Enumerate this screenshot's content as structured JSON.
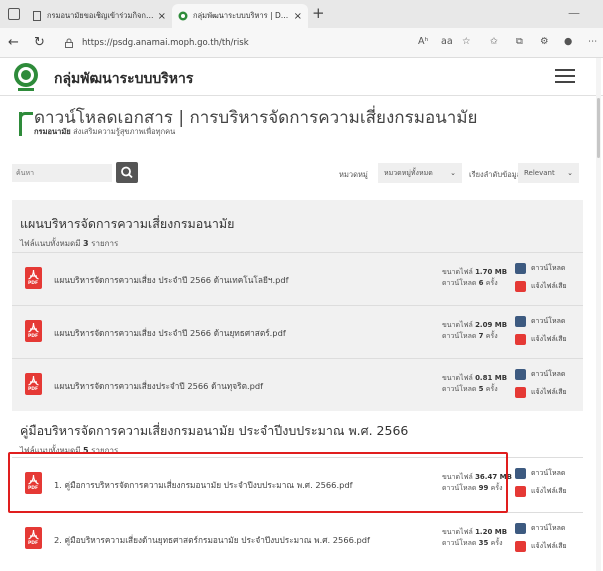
{
  "browser": {
    "tabs": [
      {
        "title": "กรมอนามัยขอเชิญเข้าร่วมกิจกรรม Inter..."
      },
      {
        "title": "กลุ่มพัฒนาระบบบริหาร | Document"
      }
    ],
    "new_tab": "+",
    "address": "https://psdg.anamai.moph.go.th/th/risk",
    "toolbar_text": "Aʰ",
    "reading": "aa"
  },
  "site": {
    "name": "กลุ่มพัฒนาระบบบริหาร"
  },
  "page": {
    "title": "ดาวน์โหลดเอกสาร | การบริหารจัดการความเสี่ยงกรมอนามัย",
    "subtitle_org": "กรมอนามัย",
    "subtitle_tagline": "ส่งเสริมความรู้สุขภาพเพื่อทุกคน"
  },
  "filters": {
    "search_placeholder": "ค้นหา",
    "category_label": "หมวดหมู่",
    "category_value": "หมวดหมู่ทั้งหมด",
    "sort_label": "เรียงลำดับข้อมูล",
    "sort_value": "Relevant"
  },
  "sections": [
    {
      "title": "แผนบริหารจัดการความเสี่ยงกรมอนามัย",
      "count_prefix": "ไฟล์แนบทั้งหมดมี",
      "count": "3",
      "count_suffix": "รายการ",
      "files": [
        {
          "name": "แผนบริหารจัดการความเสี่ยง ประจำปี 2566 ด้านเทคโนโลยีฯ.pdf",
          "size": "1.70 MB",
          "downloads": "6"
        },
        {
          "name": "แผนบริหารจัดการความเสี่ยง ประจำปี 2566 ด้านยุทธศาสตร์.pdf",
          "size": "2.09 MB",
          "downloads": "7"
        },
        {
          "name": "แผนบริหารจัดการความเสี่ยงประจำปี 2566 ด้านทุจริต.pdf",
          "size": "0.81 MB",
          "downloads": "5"
        }
      ]
    },
    {
      "title": "คู่มือบริหารจัดการความเสี่ยงกรมอนามัย ประจำปีงบประมาณ พ.ศ. 2566",
      "count_prefix": "ไฟล์แนบทั้งหมดมี",
      "count": "5",
      "count_suffix": "รายการ",
      "files": [
        {
          "name": "1. คู่มือการบริหารจัดการความเสี่ยงกรมอนามัย ประจำปีงบประมาณ พ.ศ. 2566.pdf",
          "size": "36.47 MB",
          "downloads": "99"
        },
        {
          "name": "2. คู่มือบริหารความเสี่ยงด้านยุทธศาสตร์กรมอนามัย ประจำปีงบประมาณ พ.ศ. 2566.pdf",
          "size": "1.20 MB",
          "downloads": "35"
        }
      ]
    }
  ],
  "labels": {
    "size_label": "ขนาดไฟล์",
    "downloads_label": "ดาวน์โหลด",
    "downloads_unit": "ครั้ง",
    "download_button": "ดาวน์โหลด",
    "report_button": "แจ้งไฟล์เสีย",
    "pdf_text": "PDF"
  },
  "colors": {
    "brand_green": "#2e8b3a",
    "pdf_red": "#e53935",
    "download_blue": "#3d5a80",
    "highlight_red": "#e01e1e"
  }
}
